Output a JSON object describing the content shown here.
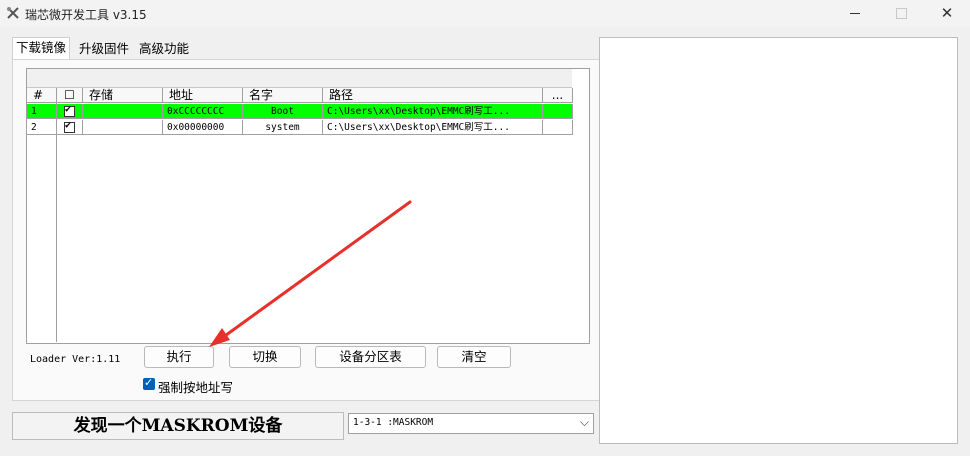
{
  "window": {
    "title": "瑞芯微开发工具 v3.15",
    "controls": {
      "minimize": "",
      "maximize": "",
      "close": "✕"
    }
  },
  "tabs": [
    {
      "label": "下载镜像",
      "active": true
    },
    {
      "label": "升级固件",
      "active": false
    },
    {
      "label": "高级功能",
      "active": false
    }
  ],
  "table": {
    "headers": {
      "num": "#",
      "check": "☐",
      "storage": "存储",
      "address": "地址",
      "name": "名字",
      "path": "路径",
      "more": "..."
    },
    "rows": [
      {
        "num": "1",
        "checked": true,
        "storage": "",
        "address": "0xCCCCCCCC",
        "name": "Boot",
        "path": "C:\\Users\\xx\\Desktop\\EMMC刷写工...",
        "selected": true
      },
      {
        "num": "2",
        "checked": true,
        "storage": "",
        "address": "0x00000000",
        "name": "system",
        "path": "C:\\Users\\xx\\Desktop\\EMMC刷写工...",
        "selected": false
      }
    ]
  },
  "loader_version": "Loader Ver:1.11",
  "buttons": {
    "execute": "执行",
    "switch": "切换",
    "partition_table": "设备分区表",
    "clear": "清空"
  },
  "force_address_write": {
    "label": "强制按地址写",
    "checked": true
  },
  "status": "发现一个MASKROM设备",
  "device_select": {
    "value": "1-3-1 :MASKROM"
  },
  "colors": {
    "selected_row": "#00ff00",
    "annotation_arrow": "#e8302a",
    "checkbox_accent": "#005fb8"
  }
}
